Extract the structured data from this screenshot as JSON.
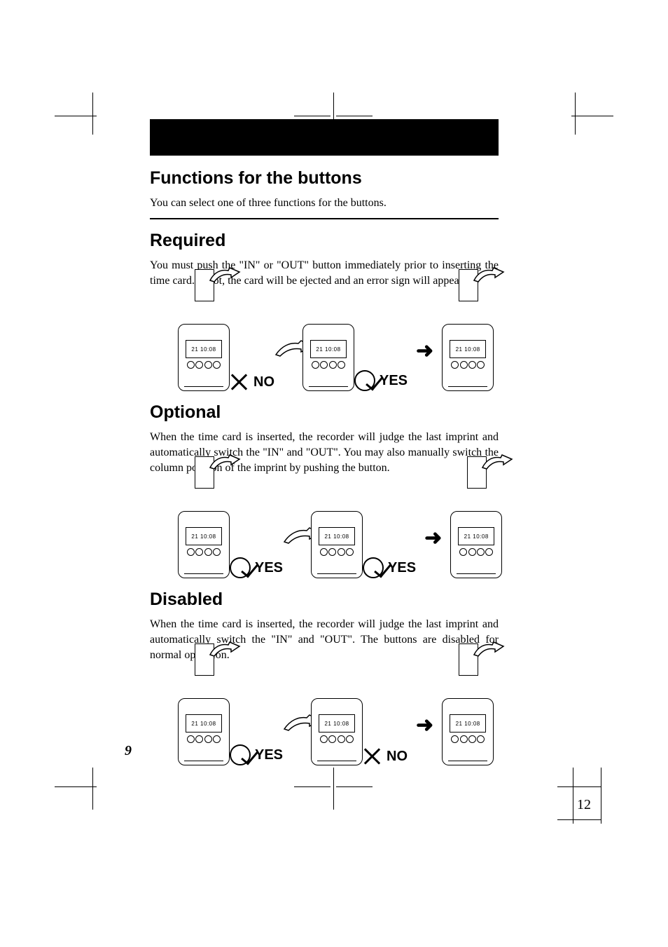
{
  "headings": {
    "functions": "Functions for the buttons",
    "required": "Required",
    "optional": "Optional",
    "disabled": "Disabled"
  },
  "paragraphs": {
    "functions": "You can select one of three functions for the buttons.",
    "required": "You must push the \"IN\" or \"OUT\" button immediately prior to inserting the time card. If not, the card will be ejected and an error sign will appear.",
    "optional": "When the time card is inserted, the recorder will judge the last imprint and automatically switch the \"IN\" and \"OUT\". You may also manually switch the column position of the imprint by pushing the button.",
    "disabled": "When the time card is inserted, the recorder will judge the last imprint and automatically switch the \"IN\" and \"OUT\". The buttons are disabled for normal operation."
  },
  "device": {
    "display_text": "21 10:08"
  },
  "labels": {
    "yes": "YES",
    "no": "NO",
    "arrow": "➜"
  },
  "page_numbers": {
    "side": "9",
    "corner": "12"
  }
}
